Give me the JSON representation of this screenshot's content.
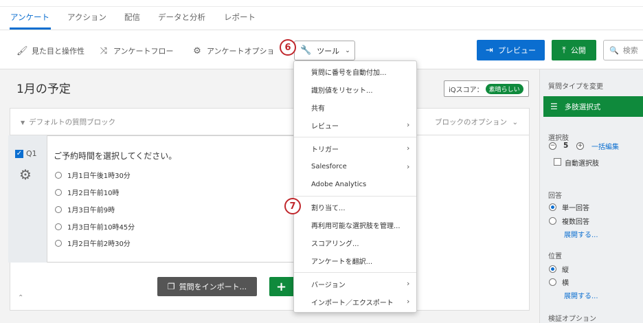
{
  "tabs": [
    "アンケート",
    "アクション",
    "配信",
    "データと分析",
    "レポート"
  ],
  "toolbar": {
    "look_feel": "見た目と操作性",
    "survey_flow": "アンケートフロー",
    "survey_options": "アンケートオプショ",
    "tools": "ツール",
    "preview": "プレビュー",
    "publish": "公開",
    "search_placeholder": "検索"
  },
  "badges": {
    "tools": "6",
    "assign": "7"
  },
  "survey": {
    "title": "1月の予定",
    "iq_label": "iQスコア：",
    "iq_value": "素晴らしい",
    "block_title": "デフォルトの質問ブロック",
    "block_options": "ブロックのオプション",
    "question": {
      "id": "Q1",
      "text": "ご予約時間を選択してください。",
      "choices": [
        "1月1日午後1時30分",
        "1月2日午前10時",
        "1月3日午前9時",
        "1月3日午前10時45分",
        "1月2日午前2時30分"
      ]
    },
    "import_label": "質問をインポート..."
  },
  "menu": {
    "items": [
      {
        "label": "質問に番号を自動付加...",
        "sub": false
      },
      {
        "label": "識別値をリセット...",
        "sub": false
      },
      {
        "label": "共有",
        "sub": false
      },
      {
        "label": "レビュー",
        "sub": true
      },
      {
        "label": "トリガー",
        "sub": true
      },
      {
        "label": "Salesforce",
        "sub": true
      },
      {
        "label": "Adobe Analytics",
        "sub": false
      },
      {
        "label": "割り当て...",
        "sub": false
      },
      {
        "label": "再利用可能な選択肢を管理...",
        "sub": false
      },
      {
        "label": "スコアリング...",
        "sub": false
      },
      {
        "label": "アンケートを翻訳...",
        "sub": false
      },
      {
        "label": "バージョン",
        "sub": true
      },
      {
        "label": "インポート／エクスポート",
        "sub": true
      }
    ]
  },
  "sidebar": {
    "change_type": "質問タイプを変更",
    "type": "多肢選択式",
    "choices_label": "選択肢",
    "choices_count": "5",
    "bulk_edit": "一括編集",
    "auto_choices": "自動選択肢",
    "answers_label": "回答",
    "single": "単一回答",
    "multiple": "複数回答",
    "expand1": "展開する...",
    "position_label": "位置",
    "vertical": "縦",
    "horizontal": "横",
    "expand2": "展開する...",
    "validation_label": "検証オプション"
  },
  "colors": {
    "accent": "#0b6ed0",
    "green": "#0f8a3c",
    "badge": "#c0262b"
  }
}
